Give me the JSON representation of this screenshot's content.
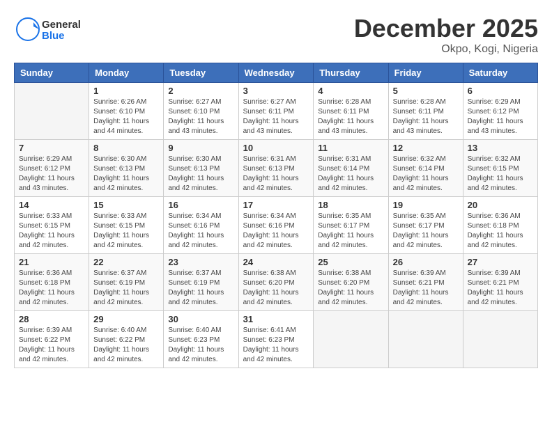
{
  "header": {
    "logo_general": "General",
    "logo_blue": "Blue",
    "month_title": "December 2025",
    "location": "Okpo, Kogi, Nigeria"
  },
  "days_of_week": [
    "Sunday",
    "Monday",
    "Tuesday",
    "Wednesday",
    "Thursday",
    "Friday",
    "Saturday"
  ],
  "weeks": [
    [
      {
        "day": "",
        "sunrise": "",
        "sunset": "",
        "daylight": ""
      },
      {
        "day": "1",
        "sunrise": "Sunrise: 6:26 AM",
        "sunset": "Sunset: 6:10 PM",
        "daylight": "Daylight: 11 hours and 44 minutes."
      },
      {
        "day": "2",
        "sunrise": "Sunrise: 6:27 AM",
        "sunset": "Sunset: 6:10 PM",
        "daylight": "Daylight: 11 hours and 43 minutes."
      },
      {
        "day": "3",
        "sunrise": "Sunrise: 6:27 AM",
        "sunset": "Sunset: 6:11 PM",
        "daylight": "Daylight: 11 hours and 43 minutes."
      },
      {
        "day": "4",
        "sunrise": "Sunrise: 6:28 AM",
        "sunset": "Sunset: 6:11 PM",
        "daylight": "Daylight: 11 hours and 43 minutes."
      },
      {
        "day": "5",
        "sunrise": "Sunrise: 6:28 AM",
        "sunset": "Sunset: 6:11 PM",
        "daylight": "Daylight: 11 hours and 43 minutes."
      },
      {
        "day": "6",
        "sunrise": "Sunrise: 6:29 AM",
        "sunset": "Sunset: 6:12 PM",
        "daylight": "Daylight: 11 hours and 43 minutes."
      }
    ],
    [
      {
        "day": "7",
        "sunrise": "Sunrise: 6:29 AM",
        "sunset": "Sunset: 6:12 PM",
        "daylight": "Daylight: 11 hours and 43 minutes."
      },
      {
        "day": "8",
        "sunrise": "Sunrise: 6:30 AM",
        "sunset": "Sunset: 6:13 PM",
        "daylight": "Daylight: 11 hours and 42 minutes."
      },
      {
        "day": "9",
        "sunrise": "Sunrise: 6:30 AM",
        "sunset": "Sunset: 6:13 PM",
        "daylight": "Daylight: 11 hours and 42 minutes."
      },
      {
        "day": "10",
        "sunrise": "Sunrise: 6:31 AM",
        "sunset": "Sunset: 6:13 PM",
        "daylight": "Daylight: 11 hours and 42 minutes."
      },
      {
        "day": "11",
        "sunrise": "Sunrise: 6:31 AM",
        "sunset": "Sunset: 6:14 PM",
        "daylight": "Daylight: 11 hours and 42 minutes."
      },
      {
        "day": "12",
        "sunrise": "Sunrise: 6:32 AM",
        "sunset": "Sunset: 6:14 PM",
        "daylight": "Daylight: 11 hours and 42 minutes."
      },
      {
        "day": "13",
        "sunrise": "Sunrise: 6:32 AM",
        "sunset": "Sunset: 6:15 PM",
        "daylight": "Daylight: 11 hours and 42 minutes."
      }
    ],
    [
      {
        "day": "14",
        "sunrise": "Sunrise: 6:33 AM",
        "sunset": "Sunset: 6:15 PM",
        "daylight": "Daylight: 11 hours and 42 minutes."
      },
      {
        "day": "15",
        "sunrise": "Sunrise: 6:33 AM",
        "sunset": "Sunset: 6:15 PM",
        "daylight": "Daylight: 11 hours and 42 minutes."
      },
      {
        "day": "16",
        "sunrise": "Sunrise: 6:34 AM",
        "sunset": "Sunset: 6:16 PM",
        "daylight": "Daylight: 11 hours and 42 minutes."
      },
      {
        "day": "17",
        "sunrise": "Sunrise: 6:34 AM",
        "sunset": "Sunset: 6:16 PM",
        "daylight": "Daylight: 11 hours and 42 minutes."
      },
      {
        "day": "18",
        "sunrise": "Sunrise: 6:35 AM",
        "sunset": "Sunset: 6:17 PM",
        "daylight": "Daylight: 11 hours and 42 minutes."
      },
      {
        "day": "19",
        "sunrise": "Sunrise: 6:35 AM",
        "sunset": "Sunset: 6:17 PM",
        "daylight": "Daylight: 11 hours and 42 minutes."
      },
      {
        "day": "20",
        "sunrise": "Sunrise: 6:36 AM",
        "sunset": "Sunset: 6:18 PM",
        "daylight": "Daylight: 11 hours and 42 minutes."
      }
    ],
    [
      {
        "day": "21",
        "sunrise": "Sunrise: 6:36 AM",
        "sunset": "Sunset: 6:18 PM",
        "daylight": "Daylight: 11 hours and 42 minutes."
      },
      {
        "day": "22",
        "sunrise": "Sunrise: 6:37 AM",
        "sunset": "Sunset: 6:19 PM",
        "daylight": "Daylight: 11 hours and 42 minutes."
      },
      {
        "day": "23",
        "sunrise": "Sunrise: 6:37 AM",
        "sunset": "Sunset: 6:19 PM",
        "daylight": "Daylight: 11 hours and 42 minutes."
      },
      {
        "day": "24",
        "sunrise": "Sunrise: 6:38 AM",
        "sunset": "Sunset: 6:20 PM",
        "daylight": "Daylight: 11 hours and 42 minutes."
      },
      {
        "day": "25",
        "sunrise": "Sunrise: 6:38 AM",
        "sunset": "Sunset: 6:20 PM",
        "daylight": "Daylight: 11 hours and 42 minutes."
      },
      {
        "day": "26",
        "sunrise": "Sunrise: 6:39 AM",
        "sunset": "Sunset: 6:21 PM",
        "daylight": "Daylight: 11 hours and 42 minutes."
      },
      {
        "day": "27",
        "sunrise": "Sunrise: 6:39 AM",
        "sunset": "Sunset: 6:21 PM",
        "daylight": "Daylight: 11 hours and 42 minutes."
      }
    ],
    [
      {
        "day": "28",
        "sunrise": "Sunrise: 6:39 AM",
        "sunset": "Sunset: 6:22 PM",
        "daylight": "Daylight: 11 hours and 42 minutes."
      },
      {
        "day": "29",
        "sunrise": "Sunrise: 6:40 AM",
        "sunset": "Sunset: 6:22 PM",
        "daylight": "Daylight: 11 hours and 42 minutes."
      },
      {
        "day": "30",
        "sunrise": "Sunrise: 6:40 AM",
        "sunset": "Sunset: 6:23 PM",
        "daylight": "Daylight: 11 hours and 42 minutes."
      },
      {
        "day": "31",
        "sunrise": "Sunrise: 6:41 AM",
        "sunset": "Sunset: 6:23 PM",
        "daylight": "Daylight: 11 hours and 42 minutes."
      },
      {
        "day": "",
        "sunrise": "",
        "sunset": "",
        "daylight": ""
      },
      {
        "day": "",
        "sunrise": "",
        "sunset": "",
        "daylight": ""
      },
      {
        "day": "",
        "sunrise": "",
        "sunset": "",
        "daylight": ""
      }
    ]
  ]
}
